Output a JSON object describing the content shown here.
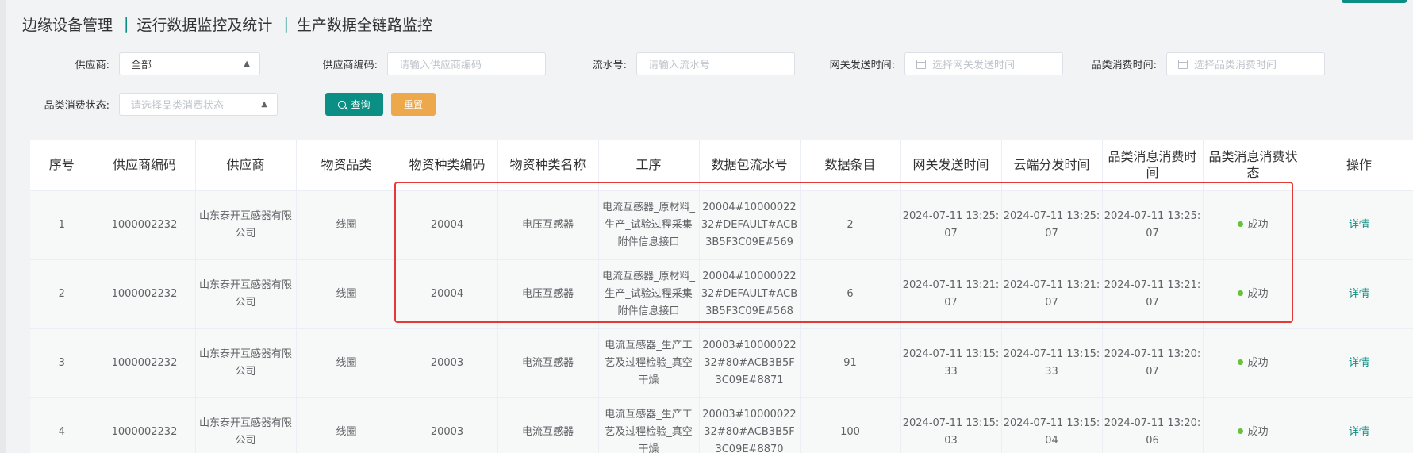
{
  "breadcrumb": {
    "items": [
      "边缘设备管理",
      "运行数据监控及统计",
      "生产数据全链路监控"
    ],
    "separator": "|"
  },
  "filters": {
    "supplier": {
      "label": "供应商:",
      "value": "全部"
    },
    "supplier_code": {
      "label": "供应商编码:",
      "placeholder": "请输入供应商编码"
    },
    "serial_no": {
      "label": "流水号:",
      "placeholder": "请输入流水号"
    },
    "gateway_time": {
      "label": "网关发送时间:",
      "placeholder": "选择网关发送时间"
    },
    "consume_time": {
      "label": "品类消费时间:",
      "placeholder": "选择品类消费时间"
    },
    "consume_status": {
      "label": "品类消费状态:",
      "placeholder": "请选择品类消费状态"
    },
    "query_button": "查询",
    "reset_button": "重置"
  },
  "table": {
    "columns": [
      "序号",
      "供应商编码",
      "供应商",
      "物资品类",
      "物资种类编码",
      "物资种类名称",
      "工序",
      "数据包流水号",
      "数据条目",
      "网关发送时间",
      "云端分发时间",
      "品类消息消费时间",
      "品类消息消费状态",
      "操作"
    ],
    "rows": [
      {
        "index": "1",
        "supplier_code": "1000002232",
        "supplier": "山东泰开互感器有限公司",
        "category": "线圈",
        "type_code": "20004",
        "type_name": "电压互感器",
        "process": "电流互感器_原材料_生产_试验过程采集附件信息接口",
        "packet_no": "20004#1000002232#DEFAULT#ACB3B5F3C09E#569",
        "count": "2",
        "gateway_time": "2024-07-11 13:25:07",
        "cloud_time": "2024-07-11 13:25:07",
        "consume_time": "2024-07-11 13:25:07",
        "status": "成功",
        "action": "详情"
      },
      {
        "index": "2",
        "supplier_code": "1000002232",
        "supplier": "山东泰开互感器有限公司",
        "category": "线圈",
        "type_code": "20004",
        "type_name": "电压互感器",
        "process": "电流互感器_原材料_生产_试验过程采集附件信息接口",
        "packet_no": "20004#1000002232#DEFAULT#ACB3B5F3C09E#568",
        "count": "6",
        "gateway_time": "2024-07-11 13:21:07",
        "cloud_time": "2024-07-11 13:21:07",
        "consume_time": "2024-07-11 13:21:07",
        "status": "成功",
        "action": "详情"
      },
      {
        "index": "3",
        "supplier_code": "1000002232",
        "supplier": "山东泰开互感器有限公司",
        "category": "线圈",
        "type_code": "20003",
        "type_name": "电流互感器",
        "process": "电流互感器_生产工艺及过程检验_真空干燥",
        "packet_no": "20003#1000002232#80#ACB3B5F3C09E#8871",
        "count": "91",
        "gateway_time": "2024-07-11 13:15:33",
        "cloud_time": "2024-07-11 13:15:33",
        "consume_time": "2024-07-11 13:20:07",
        "status": "成功",
        "action": "详情"
      },
      {
        "index": "4",
        "supplier_code": "1000002232",
        "supplier": "山东泰开互感器有限公司",
        "category": "线圈",
        "type_code": "20003",
        "type_name": "电流互感器",
        "process": "电流互感器_生产工艺及过程检验_真空干燥",
        "packet_no": "20003#1000002232#80#ACB3B5F3C09E#8870",
        "count": "100",
        "gateway_time": "2024-07-11 13:15:03",
        "cloud_time": "2024-07-11 13:15:04",
        "consume_time": "2024-07-11 13:20:06",
        "status": "成功",
        "action": "详情"
      }
    ]
  },
  "colors": {
    "accent": "#0b8e83",
    "reset": "#eca84a",
    "success": "#67c23a",
    "highlight": "#e53935"
  }
}
